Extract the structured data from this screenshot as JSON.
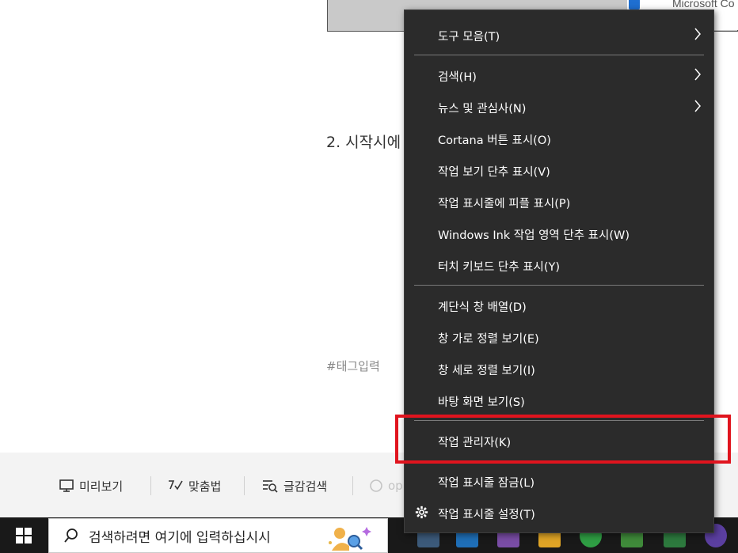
{
  "page": {
    "image_caption": "Microsoft Co",
    "heading": "2. 시작시에",
    "tag_placeholder": "#태그입력"
  },
  "toolbar": {
    "preview": "미리보기",
    "spellcheck": "맞춤법",
    "text_search": "글감검색",
    "faded": "op"
  },
  "taskbar": {
    "search_placeholder": "검색하려면 여기에 입력하십시시"
  },
  "context_menu": {
    "items": [
      {
        "label": "도구 모음(T)",
        "submenu": true
      },
      {
        "label": "검색(H)",
        "submenu": true
      },
      {
        "label": "뉴스 및 관심사(N)",
        "submenu": true
      },
      {
        "label": "Cortana 버튼 표시(O)"
      },
      {
        "label": "작업 보기 단추 표시(V)"
      },
      {
        "label": "작업 표시줄에 피플 표시(P)"
      },
      {
        "label": "Windows Ink 작업 영역 단추 표시(W)"
      },
      {
        "label": "터치 키보드 단추 표시(Y)"
      },
      {
        "label": "계단식 창 배열(D)"
      },
      {
        "label": "창 가로 정렬 보기(E)"
      },
      {
        "label": "창 세로 정렬 보기(I)"
      },
      {
        "label": "바탕 화면 보기(S)"
      },
      {
        "label": "작업 관리자(K)"
      },
      {
        "label": "작업 표시줄 잠금(L)"
      },
      {
        "label": "작업 표시줄 설정(T)",
        "icon": "gear-icon"
      }
    ]
  },
  "colors": {
    "menu_bg": "#2b2b2b",
    "highlight": "#e0141e",
    "taskbar_bg": "#191919"
  }
}
